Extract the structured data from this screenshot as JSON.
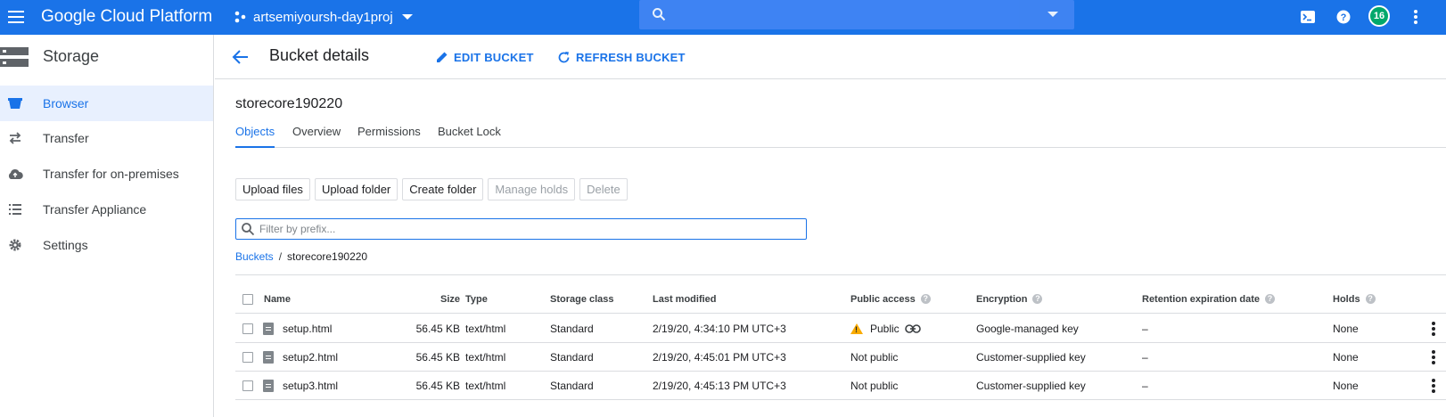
{
  "topbar": {
    "brand": "Google Cloud Platform",
    "project": "artsemiyoursh-day1proj",
    "avatar_text": "16",
    "colors": {
      "bar": "#1a73e8",
      "search": "#4285f4",
      "avatar": "#00a86b"
    },
    "icons": [
      "menu-icon",
      "project-icon",
      "search-icon",
      "cloud-shell-icon",
      "help-icon",
      "more-vert-icon"
    ]
  },
  "sidebar": {
    "title": "Storage",
    "items": [
      {
        "label": "Browser",
        "icon": "bucket-icon",
        "active": true
      },
      {
        "label": "Transfer",
        "icon": "transfer-icon",
        "active": false
      },
      {
        "label": "Transfer for on-premises",
        "icon": "cloud-upload-icon",
        "active": false
      },
      {
        "label": "Transfer Appliance",
        "icon": "list-icon",
        "active": false
      },
      {
        "label": "Settings",
        "icon": "gear-icon",
        "active": false
      }
    ]
  },
  "header": {
    "title": "Bucket details",
    "edit_label": "EDIT BUCKET",
    "refresh_label": "REFRESH BUCKET"
  },
  "bucket": {
    "name": "storecore190220",
    "tabs": [
      "Objects",
      "Overview",
      "Permissions",
      "Bucket Lock"
    ],
    "active_tab": "Objects"
  },
  "actions": {
    "upload_files": "Upload files",
    "upload_folder": "Upload folder",
    "create_folder": "Create folder",
    "manage_holds": "Manage holds",
    "delete": "Delete"
  },
  "filter": {
    "placeholder": "Filter by prefix..."
  },
  "breadcrumb": {
    "root": "Buckets",
    "separator": "/",
    "current": "storecore190220"
  },
  "table": {
    "columns": {
      "name": "Name",
      "size": "Size",
      "type": "Type",
      "storage_class": "Storage class",
      "last_modified": "Last modified",
      "public_access": "Public access",
      "encryption": "Encryption",
      "retention": "Retention expiration date",
      "holds": "Holds"
    },
    "rows": [
      {
        "name": "setup.html",
        "size": "56.45 KB",
        "type": "text/html",
        "storage_class": "Standard",
        "last_modified": "2/19/20, 4:34:10 PM UTC+3",
        "public_access": "Public",
        "encryption": "Google-managed key",
        "retention": "–",
        "holds": "None"
      },
      {
        "name": "setup2.html",
        "size": "56.45 KB",
        "type": "text/html",
        "storage_class": "Standard",
        "last_modified": "2/19/20, 4:45:01 PM UTC+3",
        "public_access": "Not public",
        "encryption": "Customer-supplied key",
        "retention": "–",
        "holds": "None"
      },
      {
        "name": "setup3.html",
        "size": "56.45 KB",
        "type": "text/html",
        "storage_class": "Standard",
        "last_modified": "2/19/20, 4:45:13 PM UTC+3",
        "public_access": "Not public",
        "encryption": "Customer-supplied key",
        "retention": "–",
        "holds": "None"
      }
    ]
  }
}
